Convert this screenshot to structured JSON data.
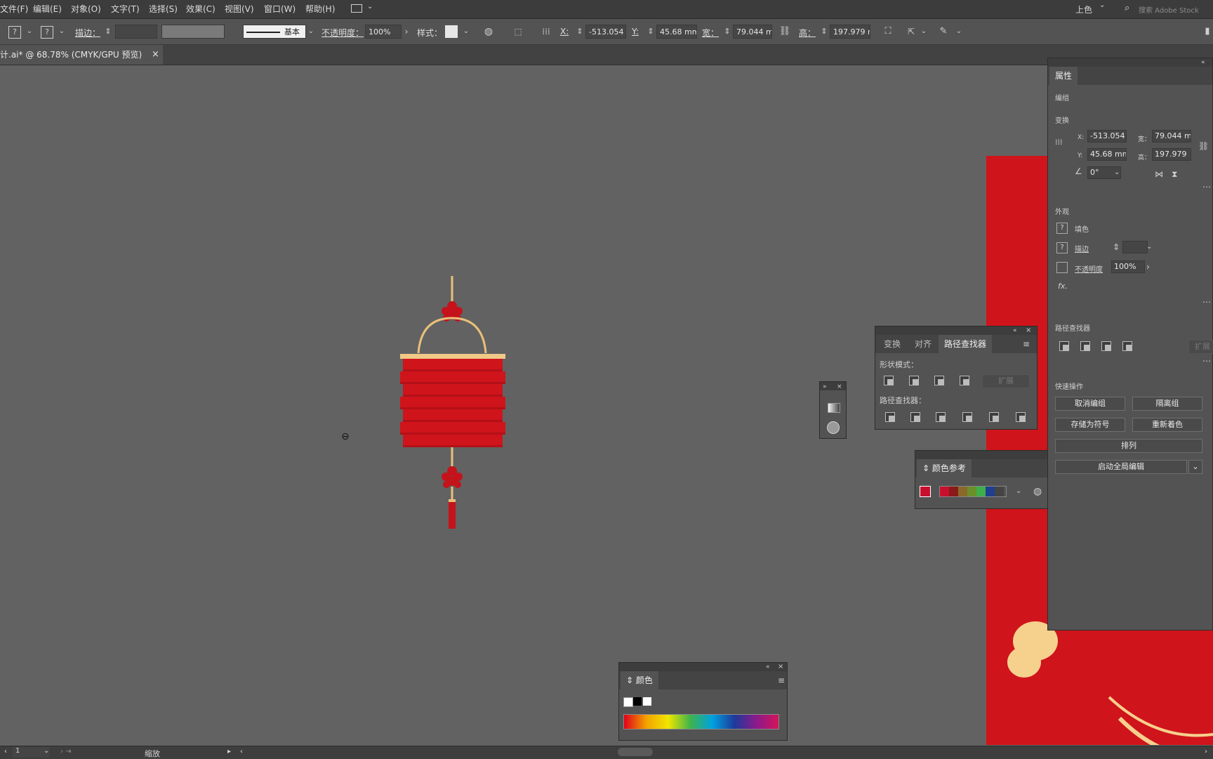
{
  "menu": [
    "文件(F)",
    "编辑(E)",
    "对象(O)",
    "文字(T)",
    "选择(S)",
    "效果(C)",
    "视图(V)",
    "窗口(W)",
    "帮助(H)"
  ],
  "workspace": "上色",
  "search_placeholder": "搜索 Adobe Stock",
  "control": {
    "stroke_label": "描边：",
    "brush_label": "基本",
    "opacity_label": "不透明度：",
    "opacity_value": "100%",
    "style_label": "样式：",
    "x_label": "X:",
    "x_value": "-513.054",
    "y_label": "Y:",
    "y_value": "45.68 mm",
    "w_label": "宽：",
    "w_value": "79.044 mm",
    "h_label": "高：",
    "h_value": "197.979 m"
  },
  "doc_tab": {
    "title": "计.ai* @ 68.78% (CMYK/GPU 预览)",
    "close": "×"
  },
  "properties": {
    "tab": "属性",
    "group_label": "编组",
    "transform_label": "变换",
    "x_label": "X:",
    "x_value": "-513.054",
    "y_label": "Y:",
    "y_value": "45.68 mm",
    "w_label": "宽：",
    "w_value": "79.044 m",
    "h_label": "高：",
    "h_value": "197.979",
    "angle_value": "0°",
    "appearance_label": "外观",
    "fill_label": "填色",
    "stroke_label": "描边",
    "opacity_label": "不透明度",
    "opacity_value": "100%",
    "fx_label": "fx.",
    "pathfinder_label": "路径查找器",
    "expand_label": "扩展",
    "quick_actions_label": "快速操作",
    "btn_ungroup": "取消编组",
    "btn_isolate": "隔离组",
    "btn_save_symbol": "存储为符号",
    "btn_recolor": "重新着色",
    "btn_arrange": "排列",
    "btn_global_edit": "启动全局编辑"
  },
  "pathfinder_panel": {
    "tabs": [
      "变换",
      "对齐",
      "路径查找器"
    ],
    "shape_modes_label": "形状模式：",
    "expand_label": "扩展",
    "pathfinders_label": "路径查找器："
  },
  "color_guide": {
    "tab": "颜色参考",
    "swatches": [
      "#c8102e",
      "#8b1a1a",
      "#8a6a2a",
      "#6b8f2a",
      "#3fae4a",
      "#1f3f8f",
      "#444444"
    ]
  },
  "color_panel": {
    "tab": "颜色"
  },
  "status": {
    "zoom_value": "1",
    "tool_label": "缩放"
  },
  "colors": {
    "lantern_red": "#cf141b",
    "gold": "#e8c07a",
    "artboard": "#cf141b"
  }
}
